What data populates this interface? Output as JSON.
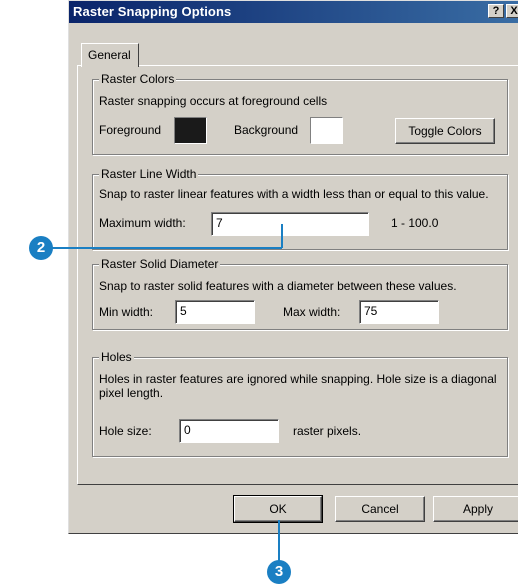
{
  "window": {
    "title": "Raster Snapping Options",
    "help_label": "?",
    "close_label": "X"
  },
  "tabs": [
    {
      "label": "General"
    }
  ],
  "raster_colors": {
    "legend": "Raster Colors",
    "description": "Raster snapping occurs at foreground cells",
    "foreground_label": "Foreground",
    "foreground_color": "#1a1a1a",
    "background_label": "Background",
    "background_color": "#ffffff",
    "toggle_label": "Toggle Colors"
  },
  "line_width": {
    "legend": "Raster Line Width",
    "description": "Snap to raster linear features with a width less than or equal to this value.",
    "max_label": "Maximum width:",
    "max_value": "7",
    "range_label": "1 - 100.0"
  },
  "solid_diameter": {
    "legend": "Raster Solid Diameter",
    "description": "Snap to raster solid features with a diameter between these values.",
    "min_label": "Min width:",
    "min_value": "5",
    "max_label": "Max width:",
    "max_value": "75"
  },
  "holes": {
    "legend": "Holes",
    "description": "Holes in raster features are ignored while snapping.  Hole size is a diagonal pixel length.",
    "size_label": "Hole size:",
    "size_value": "0",
    "unit_label": "raster pixels."
  },
  "buttons": {
    "ok": "OK",
    "cancel": "Cancel",
    "apply": "Apply"
  },
  "callouts": [
    {
      "number": "2"
    },
    {
      "number": "3"
    }
  ],
  "colors": {
    "callout": "#1a7fc3",
    "titlebar": "#0a246a"
  }
}
